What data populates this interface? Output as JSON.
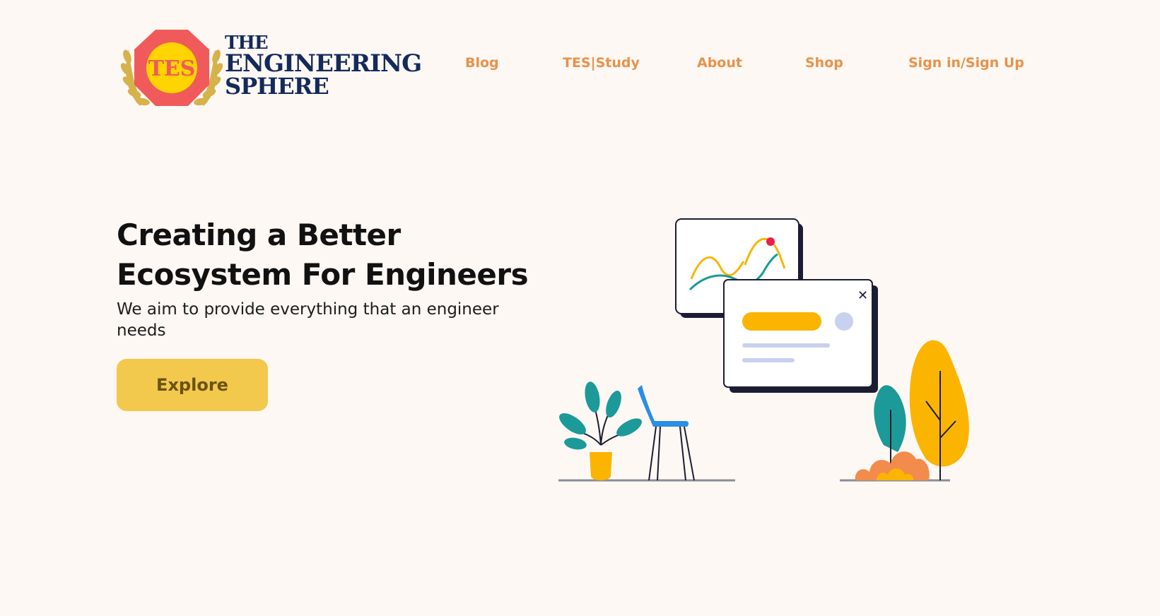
{
  "brand": {
    "emblem_text": "TES",
    "line1": "THE",
    "line2": "ENGINEERING",
    "line3": "SPHERE"
  },
  "nav": {
    "items": [
      "Blog",
      "TES|Study",
      "About",
      "Shop",
      "Sign in/Sign Up"
    ]
  },
  "hero": {
    "title_line1": "Creating a Better",
    "title_line2": "Ecosystem For Engineers",
    "subtitle": "We aim to provide everything that an engineer needs",
    "cta_label": "Explore"
  },
  "popup": {
    "close_glyph": "✕"
  },
  "colors": {
    "background": "#fdf8f3",
    "nav_link": "#e8914a",
    "button": "#f2c94c",
    "button_text": "#6b5312",
    "brand_navy": "#142a5c",
    "emblem_red": "#f15a5a",
    "emblem_yellow": "#ffd400",
    "accent_yellow": "#fbb400",
    "teal": "#1b9a99",
    "chair_blue": "#2a8ee6",
    "orange": "#f28b4b"
  }
}
